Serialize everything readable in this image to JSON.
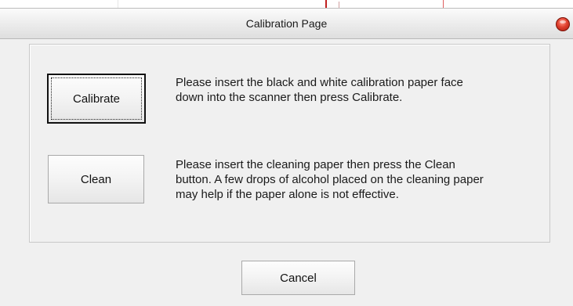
{
  "window": {
    "title": "Calibration Page"
  },
  "calibrate": {
    "button_label": "Calibrate",
    "instruction_line1": "Please insert the black and white calibration paper face",
    "instruction_line2": "down into the scanner then press Calibrate."
  },
  "clean": {
    "button_label": "Clean",
    "instruction_line1": "Please insert the cleaning paper then press the Clean",
    "instruction_line2": "button. A few drops of alcohol placed on the cleaning paper",
    "instruction_line3": "may help if the paper alone is not effective."
  },
  "footer": {
    "cancel_label": "Cancel"
  },
  "icons": {
    "close": "close-icon"
  },
  "colors": {
    "close_button": "#e0402e",
    "dialog_background": "#f0f0f0"
  }
}
